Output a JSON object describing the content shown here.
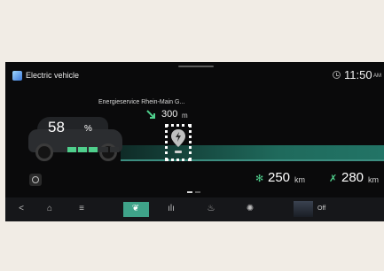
{
  "header": {
    "app_title": "Electric vehicle",
    "time": "11:50",
    "ampm": "AM"
  },
  "vehicle": {
    "battery_percent": "58",
    "percent_sign": "%",
    "battery_level": 0.58
  },
  "navigation": {
    "station_name": "Energieservice Rhein-Main G...",
    "distance": "300",
    "distance_unit": "m"
  },
  "range": {
    "range_1": "250",
    "range_1_unit": "km",
    "range_2": "280",
    "range_2_unit": "km"
  },
  "bottom_nav": {
    "items": [
      {
        "icon": "back-icon",
        "glyph": "<"
      },
      {
        "icon": "home-icon",
        "glyph": "⌂"
      },
      {
        "icon": "menu-icon",
        "glyph": "≡"
      },
      {
        "icon": "leaf-icon",
        "glyph": "❦"
      },
      {
        "icon": "chart-icon",
        "glyph": "ılı"
      },
      {
        "icon": "seat-icon",
        "glyph": "♨"
      },
      {
        "icon": "settings-icon",
        "glyph": "✺"
      }
    ],
    "media_label": "Off"
  },
  "colors": {
    "accent": "#4fcf8c",
    "active_tab": "#3fa389",
    "road": "#1f6a5c"
  }
}
